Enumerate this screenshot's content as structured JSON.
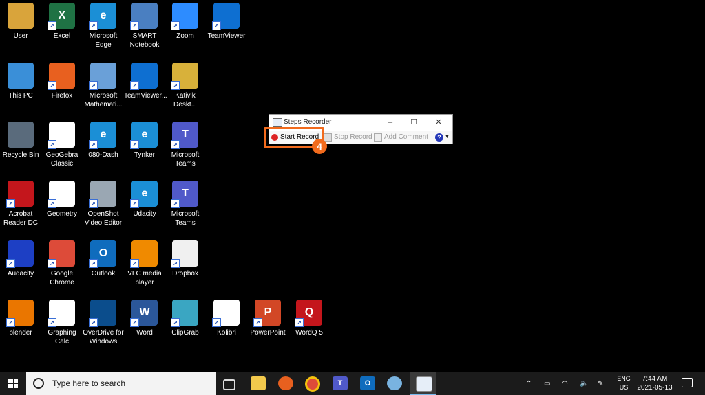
{
  "desktop_icons": [
    {
      "label": "User",
      "color": "#d9a43b",
      "glyph": "",
      "shortcut": false
    },
    {
      "label": "Excel",
      "color": "#1f7244",
      "glyph": "X",
      "shortcut": true
    },
    {
      "label": "Microsoft Edge",
      "color": "#1b8fd6",
      "glyph": "e",
      "shortcut": true
    },
    {
      "label": "SMART Notebook",
      "color": "#4a7fc1",
      "glyph": "",
      "shortcut": true
    },
    {
      "label": "Zoom",
      "color": "#2d8cff",
      "glyph": "",
      "shortcut": true
    },
    {
      "label": "TeamViewer",
      "color": "#0e6fd1",
      "glyph": "",
      "shortcut": true
    },
    {
      "label": "This PC",
      "color": "#3a8fd8",
      "glyph": "",
      "shortcut": false
    },
    {
      "label": "Firefox",
      "color": "#e8601f",
      "glyph": "",
      "shortcut": true
    },
    {
      "label": "Microsoft Mathemati...",
      "color": "#6aa0d8",
      "glyph": "",
      "shortcut": true
    },
    {
      "label": "TeamViewer...",
      "color": "#0e6fd1",
      "glyph": "",
      "shortcut": true
    },
    {
      "label": "Kativik Deskt...",
      "color": "#d8b13a",
      "glyph": "",
      "shortcut": true
    },
    {
      "label": "Recycle Bin",
      "color": "#5a6b7c",
      "glyph": "",
      "shortcut": false
    },
    {
      "label": "GeoGebra Classic",
      "color": "#ffffff",
      "glyph": "",
      "shortcut": true
    },
    {
      "label": "080-Dash",
      "color": "#1b8fd6",
      "glyph": "e",
      "shortcut": true
    },
    {
      "label": "Tynker",
      "color": "#1b8fd6",
      "glyph": "e",
      "shortcut": true
    },
    {
      "label": "Microsoft Teams",
      "color": "#5059c9",
      "glyph": "T",
      "shortcut": true
    },
    {
      "label": "Acrobat Reader DC",
      "color": "#c4161c",
      "glyph": "",
      "shortcut": true
    },
    {
      "label": "Geometry",
      "color": "#ffffff",
      "glyph": "",
      "shortcut": true
    },
    {
      "label": "OpenShot Video Editor",
      "color": "#9aa7b3",
      "glyph": "",
      "shortcut": true
    },
    {
      "label": "Udacity",
      "color": "#1b8fd6",
      "glyph": "e",
      "shortcut": true
    },
    {
      "label": "Microsoft Teams",
      "color": "#5059c9",
      "glyph": "T",
      "shortcut": true
    },
    {
      "label": "Audacity",
      "color": "#1d3fc4",
      "glyph": "",
      "shortcut": true
    },
    {
      "label": "Google Chrome",
      "color": "#dd4b39",
      "glyph": "",
      "shortcut": true
    },
    {
      "label": "Outlook",
      "color": "#0f6cbd",
      "glyph": "O",
      "shortcut": true
    },
    {
      "label": "VLC media player",
      "color": "#f08a00",
      "glyph": "",
      "shortcut": true
    },
    {
      "label": "Dropbox",
      "color": "#f0f0f0",
      "glyph": "",
      "shortcut": true
    },
    {
      "label": "blender",
      "color": "#ea7600",
      "glyph": "",
      "shortcut": true
    },
    {
      "label": "Graphing Calc",
      "color": "#ffffff",
      "glyph": "",
      "shortcut": true
    },
    {
      "label": "OverDrive for Windows",
      "color": "#0b4d8c",
      "glyph": "",
      "shortcut": true
    },
    {
      "label": "Word",
      "color": "#2b579a",
      "glyph": "W",
      "shortcut": true
    },
    {
      "label": "ClipGrab",
      "color": "#3aa6c2",
      "glyph": "",
      "shortcut": true
    },
    {
      "label": "Kolibri",
      "color": "#ffffff",
      "glyph": "",
      "shortcut": true
    },
    {
      "label": "PowerPoint",
      "color": "#d24726",
      "glyph": "P",
      "shortcut": true
    },
    {
      "label": "WordQ 5",
      "color": "#c4161c",
      "glyph": "Q",
      "shortcut": true
    }
  ],
  "steps_recorder": {
    "title": "Steps Recorder",
    "start_label": "Start Record",
    "stop_label": "Stop Record",
    "comment_label": "Add Comment",
    "help_glyph": "?",
    "minimize": "–",
    "maximize": "☐",
    "close": "✕"
  },
  "annotation": {
    "step_number": "4",
    "highlight_color": "#f26b1d"
  },
  "taskbar": {
    "search_placeholder": "Type here to search",
    "lang_top": "ENG",
    "lang_bottom": "US",
    "time": "7:44 AM",
    "date": "2021-05-13",
    "pinned": [
      "task-view",
      "file-explorer",
      "firefox",
      "chrome",
      "teams",
      "outlook",
      "paint",
      "steps-recorder"
    ]
  }
}
